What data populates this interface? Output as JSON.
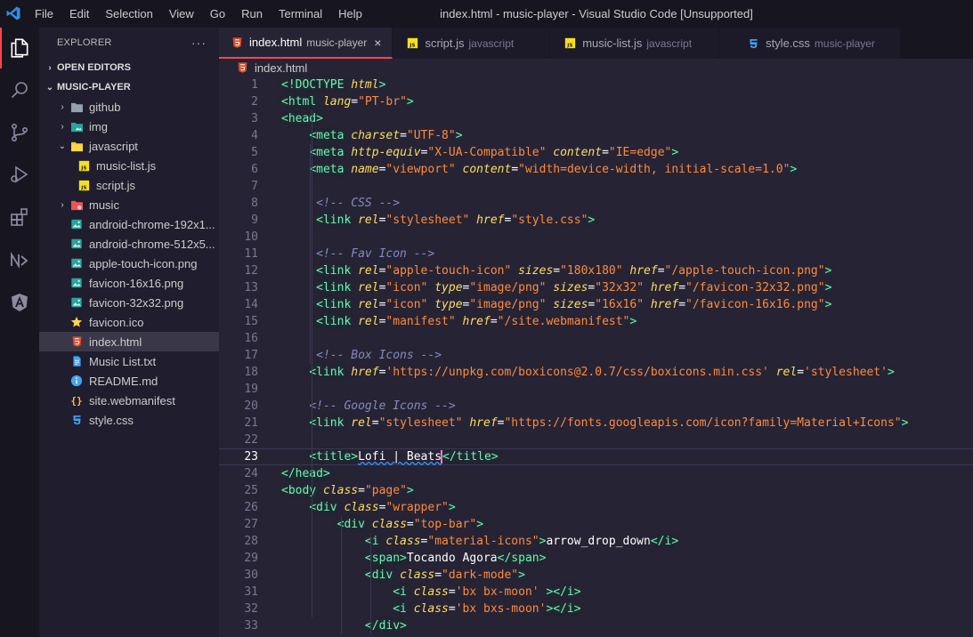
{
  "titlebar": {
    "menu": [
      "File",
      "Edit",
      "Selection",
      "View",
      "Go",
      "Run",
      "Terminal",
      "Help"
    ],
    "title": "index.html - music-player - Visual Studio Code [Unsupported]"
  },
  "activity": [
    "explorer-icon",
    "search-icon",
    "source-control-icon",
    "run-debug-icon",
    "extensions-icon",
    "nx-icon",
    "angular-icon"
  ],
  "sidebar": {
    "header": "EXPLORER",
    "more": "···",
    "sections": {
      "open_editors": "OPEN EDITORS",
      "project": "MUSIC-PLAYER"
    },
    "items": [
      {
        "label": "github",
        "type": "folder",
        "indent": 1,
        "chevron": "›"
      },
      {
        "label": "img",
        "type": "folder-img",
        "indent": 1,
        "chevron": "›"
      },
      {
        "label": "javascript",
        "type": "folder-js",
        "indent": 1,
        "chevron": "⌄"
      },
      {
        "label": "music-list.js",
        "type": "js",
        "indent": 2
      },
      {
        "label": "script.js",
        "type": "js",
        "indent": 2
      },
      {
        "label": "music",
        "type": "folder-music",
        "indent": 1,
        "chevron": "›"
      },
      {
        "label": "android-chrome-192x1...",
        "type": "png",
        "indent": 1
      },
      {
        "label": "android-chrome-512x5...",
        "type": "png",
        "indent": 1
      },
      {
        "label": "apple-touch-icon.png",
        "type": "png",
        "indent": 1
      },
      {
        "label": "favicon-16x16.png",
        "type": "png",
        "indent": 1
      },
      {
        "label": "favicon-32x32.png",
        "type": "png",
        "indent": 1
      },
      {
        "label": "favicon.ico",
        "type": "ico",
        "indent": 1
      },
      {
        "label": "index.html",
        "type": "html",
        "indent": 1,
        "active": true
      },
      {
        "label": "Music List.txt",
        "type": "txt",
        "indent": 1
      },
      {
        "label": "README.md",
        "type": "md",
        "indent": 1
      },
      {
        "label": "site.webmanifest",
        "type": "json",
        "indent": 1
      },
      {
        "label": "style.css",
        "type": "css",
        "indent": 1
      }
    ]
  },
  "tabs": [
    {
      "label": "index.html",
      "desc": "music-player",
      "type": "html",
      "active": true,
      "close": "×"
    },
    {
      "label": "script.js",
      "desc": "javascript",
      "type": "js"
    },
    {
      "label": "music-list.js",
      "desc": "javascript",
      "type": "js"
    },
    {
      "label": "style.css",
      "desc": "music-player",
      "type": "css"
    }
  ],
  "breadcrumb": "index.html",
  "editor": {
    "current_line": 23,
    "lines": [
      [
        [
          "tag",
          "<!DOCTYPE "
        ],
        [
          "attr",
          "html"
        ],
        [
          "tag",
          ">"
        ]
      ],
      [
        [
          "tag",
          "<html "
        ],
        [
          "attr",
          "lang"
        ],
        [
          "eq",
          "="
        ],
        [
          "str",
          "\"PT-br\""
        ],
        [
          "tag",
          ">"
        ]
      ],
      [
        [
          "tag",
          "<head>"
        ]
      ],
      [
        [
          "txt",
          "    "
        ],
        [
          "tag",
          "<meta "
        ],
        [
          "attr",
          "charset"
        ],
        [
          "eq",
          "="
        ],
        [
          "str",
          "\"UTF-8\""
        ],
        [
          "tag",
          ">"
        ]
      ],
      [
        [
          "txt",
          "    "
        ],
        [
          "tag",
          "<meta "
        ],
        [
          "attr",
          "http-equiv"
        ],
        [
          "eq",
          "="
        ],
        [
          "str",
          "\"X-UA-Compatible\""
        ],
        [
          "txt",
          " "
        ],
        [
          "attr",
          "content"
        ],
        [
          "eq",
          "="
        ],
        [
          "str",
          "\"IE=edge\""
        ],
        [
          "tag",
          ">"
        ]
      ],
      [
        [
          "txt",
          "    "
        ],
        [
          "tag",
          "<meta "
        ],
        [
          "attr",
          "name"
        ],
        [
          "eq",
          "="
        ],
        [
          "str",
          "\"viewport\""
        ],
        [
          "txt",
          " "
        ],
        [
          "attr",
          "content"
        ],
        [
          "eq",
          "="
        ],
        [
          "str",
          "\"width=device-width, initial-scale=1.0\""
        ],
        [
          "tag",
          ">"
        ]
      ],
      [],
      [
        [
          "txt",
          "     "
        ],
        [
          "cm",
          "<!-- CSS -->"
        ]
      ],
      [
        [
          "txt",
          "     "
        ],
        [
          "tag",
          "<link "
        ],
        [
          "attr",
          "rel"
        ],
        [
          "eq",
          "="
        ],
        [
          "str",
          "\"stylesheet\""
        ],
        [
          "txt",
          " "
        ],
        [
          "attr",
          "href"
        ],
        [
          "eq",
          "="
        ],
        [
          "str",
          "\"style.css\""
        ],
        [
          "tag",
          ">"
        ]
      ],
      [],
      [
        [
          "txt",
          "     "
        ],
        [
          "cm",
          "<!-- Fav Icon -->"
        ]
      ],
      [
        [
          "txt",
          "     "
        ],
        [
          "tag",
          "<link "
        ],
        [
          "attr",
          "rel"
        ],
        [
          "eq",
          "="
        ],
        [
          "str",
          "\"apple-touch-icon\""
        ],
        [
          "txt",
          " "
        ],
        [
          "attr",
          "sizes"
        ],
        [
          "eq",
          "="
        ],
        [
          "str",
          "\"180x180\""
        ],
        [
          "txt",
          " "
        ],
        [
          "attr",
          "href"
        ],
        [
          "eq",
          "="
        ],
        [
          "str",
          "\"/apple-touch-icon.png\""
        ],
        [
          "tag",
          ">"
        ]
      ],
      [
        [
          "txt",
          "     "
        ],
        [
          "tag",
          "<link "
        ],
        [
          "attr",
          "rel"
        ],
        [
          "eq",
          "="
        ],
        [
          "str",
          "\"icon\""
        ],
        [
          "txt",
          " "
        ],
        [
          "attr",
          "type"
        ],
        [
          "eq",
          "="
        ],
        [
          "str",
          "\"image/png\""
        ],
        [
          "txt",
          " "
        ],
        [
          "attr",
          "sizes"
        ],
        [
          "eq",
          "="
        ],
        [
          "str",
          "\"32x32\""
        ],
        [
          "txt",
          " "
        ],
        [
          "attr",
          "href"
        ],
        [
          "eq",
          "="
        ],
        [
          "str",
          "\"/favicon-32x32.png\""
        ],
        [
          "tag",
          ">"
        ]
      ],
      [
        [
          "txt",
          "     "
        ],
        [
          "tag",
          "<link "
        ],
        [
          "attr",
          "rel"
        ],
        [
          "eq",
          "="
        ],
        [
          "str",
          "\"icon\""
        ],
        [
          "txt",
          " "
        ],
        [
          "attr",
          "type"
        ],
        [
          "eq",
          "="
        ],
        [
          "str",
          "\"image/png\""
        ],
        [
          "txt",
          " "
        ],
        [
          "attr",
          "sizes"
        ],
        [
          "eq",
          "="
        ],
        [
          "str",
          "\"16x16\""
        ],
        [
          "txt",
          " "
        ],
        [
          "attr",
          "href"
        ],
        [
          "eq",
          "="
        ],
        [
          "str",
          "\"/favicon-16x16.png\""
        ],
        [
          "tag",
          ">"
        ]
      ],
      [
        [
          "txt",
          "     "
        ],
        [
          "tag",
          "<link "
        ],
        [
          "attr",
          "rel"
        ],
        [
          "eq",
          "="
        ],
        [
          "str",
          "\"manifest\""
        ],
        [
          "txt",
          " "
        ],
        [
          "attr",
          "href"
        ],
        [
          "eq",
          "="
        ],
        [
          "str",
          "\"/site.webmanifest\""
        ],
        [
          "tag",
          ">"
        ]
      ],
      [],
      [
        [
          "txt",
          "     "
        ],
        [
          "cm",
          "<!-- Box Icons -->"
        ]
      ],
      [
        [
          "txt",
          "    "
        ],
        [
          "tag",
          "<link "
        ],
        [
          "attr",
          "href"
        ],
        [
          "eq",
          "="
        ],
        [
          "str",
          "'https://unpkg.com/boxicons@2.0.7/css/boxicons.min.css'"
        ],
        [
          "txt",
          " "
        ],
        [
          "attr",
          "rel"
        ],
        [
          "eq",
          "="
        ],
        [
          "str",
          "'stylesheet'"
        ],
        [
          "tag",
          ">"
        ]
      ],
      [],
      [
        [
          "txt",
          "    "
        ],
        [
          "cm",
          "<!-- Google Icons -->"
        ]
      ],
      [
        [
          "txt",
          "    "
        ],
        [
          "tag",
          "<link "
        ],
        [
          "attr",
          "rel"
        ],
        [
          "eq",
          "="
        ],
        [
          "str",
          "\"stylesheet\""
        ],
        [
          "txt",
          " "
        ],
        [
          "attr",
          "href"
        ],
        [
          "eq",
          "="
        ],
        [
          "str",
          "\"https://fonts.googleapis.com/icon?family=Material+Icons\""
        ],
        [
          "tag",
          ">"
        ]
      ],
      [],
      [
        [
          "txt",
          "    "
        ],
        [
          "tag",
          "<title>"
        ],
        [
          "txt",
          "Lofi | Beats"
        ],
        [
          "caret",
          ""
        ],
        [
          "tag",
          "</title>"
        ]
      ],
      [
        [
          "tag",
          "</head>"
        ]
      ],
      [
        [
          "tag",
          "<body "
        ],
        [
          "attr",
          "class"
        ],
        [
          "eq",
          "="
        ],
        [
          "str",
          "\"page\""
        ],
        [
          "tag",
          ">"
        ]
      ],
      [
        [
          "txt",
          "    "
        ],
        [
          "tag",
          "<div "
        ],
        [
          "attr",
          "class"
        ],
        [
          "eq",
          "="
        ],
        [
          "str",
          "\"wrapper\""
        ],
        [
          "tag",
          ">"
        ]
      ],
      [
        [
          "txt",
          "        "
        ],
        [
          "tag",
          "<div "
        ],
        [
          "attr",
          "class"
        ],
        [
          "eq",
          "="
        ],
        [
          "str",
          "\"top-bar\""
        ],
        [
          "tag",
          ">"
        ]
      ],
      [
        [
          "txt",
          "            "
        ],
        [
          "tag",
          "<i "
        ],
        [
          "attr",
          "class"
        ],
        [
          "eq",
          "="
        ],
        [
          "str",
          "\"material-icons\""
        ],
        [
          "tag",
          ">"
        ],
        [
          "txt",
          "arrow_drop_down"
        ],
        [
          "tag",
          "</i>"
        ]
      ],
      [
        [
          "txt",
          "            "
        ],
        [
          "tag",
          "<span>"
        ],
        [
          "txt",
          "Tocando Agora"
        ],
        [
          "tag",
          "</span>"
        ]
      ],
      [
        [
          "txt",
          "            "
        ],
        [
          "tag",
          "<div "
        ],
        [
          "attr",
          "class"
        ],
        [
          "eq",
          "="
        ],
        [
          "str",
          "\"dark-mode\""
        ],
        [
          "tag",
          ">"
        ]
      ],
      [
        [
          "txt",
          "                "
        ],
        [
          "tag",
          "<i "
        ],
        [
          "attr",
          "class"
        ],
        [
          "eq",
          "="
        ],
        [
          "str",
          "'bx bx-moon'"
        ],
        [
          "txt",
          " "
        ],
        [
          "tag",
          "></i>"
        ]
      ],
      [
        [
          "txt",
          "                "
        ],
        [
          "tag",
          "<i "
        ],
        [
          "attr",
          "class"
        ],
        [
          "eq",
          "="
        ],
        [
          "str",
          "'bx bxs-moon'"
        ],
        [
          "tag",
          "></i>"
        ]
      ],
      [
        [
          "txt",
          "            "
        ],
        [
          "tag",
          "</div>"
        ]
      ]
    ]
  },
  "colors": {
    "accent": "#fe4450",
    "tag": "#72f1b8",
    "attr": "#fede5d",
    "string": "#ff8b39",
    "comment": "#848bbd",
    "bg": "#262335"
  }
}
